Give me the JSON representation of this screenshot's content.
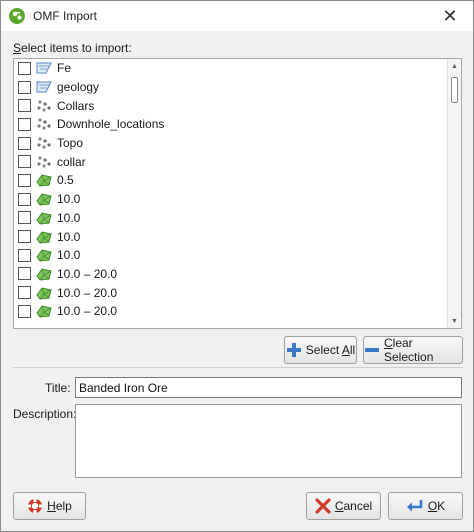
{
  "window": {
    "title": "OMF Import"
  },
  "select_label": {
    "accel": "S",
    "rest": "elect items to import:"
  },
  "items": [
    {
      "label": "Fe",
      "icon": "grid-icon"
    },
    {
      "label": "geology",
      "icon": "grid-icon"
    },
    {
      "label": "Collars",
      "icon": "points-icon"
    },
    {
      "label": "Downhole_locations",
      "icon": "points-icon"
    },
    {
      "label": "Topo",
      "icon": "points-icon"
    },
    {
      "label": "collar",
      "icon": "points-icon"
    },
    {
      "label": "0.5",
      "icon": "surface-icon"
    },
    {
      "label": "10.0",
      "icon": "surface-icon"
    },
    {
      "label": "10.0",
      "icon": "surface-icon"
    },
    {
      "label": "10.0",
      "icon": "surface-icon"
    },
    {
      "label": "10.0",
      "icon": "surface-icon"
    },
    {
      "label": "10.0 – 20.0",
      "icon": "surface-icon"
    },
    {
      "label": "10.0 – 20.0",
      "icon": "surface-icon"
    },
    {
      "label": "10.0 – 20.0",
      "icon": "surface-icon"
    }
  ],
  "buttons": {
    "select_all": {
      "pre": "Select ",
      "accel": "A",
      "post": "ll"
    },
    "clear_selection": {
      "accel": "C",
      "post": "lear Selection"
    },
    "help": {
      "accel": "H",
      "post": "elp"
    },
    "cancel": {
      "accel": "C",
      "post": "ancel"
    },
    "ok": {
      "accel": "O",
      "post": "K"
    }
  },
  "form": {
    "title_label": "Title:",
    "title_value": "Banded Iron Ore",
    "description_label": "Description:",
    "description_value": ""
  },
  "colors": {
    "accent_green": "#4fa83a",
    "accent_blue": "#3a78c8",
    "danger_red": "#d23a2a"
  }
}
